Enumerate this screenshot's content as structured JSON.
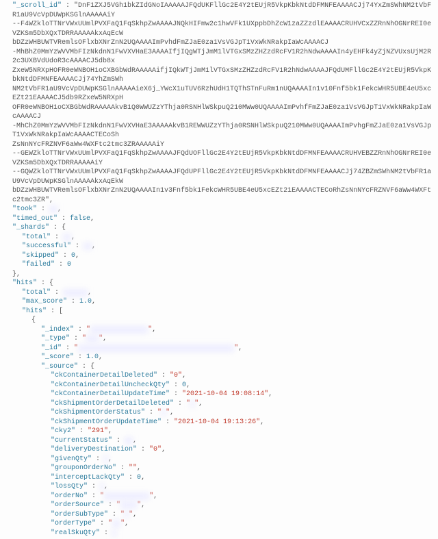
{
  "scroll_id_key": "\"_scroll_id\"",
  "scroll_id_lines": [
    "\"DnF1ZXJ5VGh1bkZIdGNoIAAAAAJFQdUKFllGc2E4Y2tEUjR5VkpKbkNtdDFMNFEAAAACJj74YxZmSWhNM2tVbFR1aU9VcVpDUWpKSGlnAAAAAiY",
    "--F4WZkloTTNrVWxUUmlPVXFaQ1FqSkhpZwAAAAJNQkHIFmw2c1hwVFk1UXppbDhZcW1zaZZzdlEAAAACRUHVCxZZRnNhOGNrREI0eVZKSm5DbXQxTDRRAAAAAkxAqEcW",
    "bDZzWHBUWTVRemlsOFlxbXNrZnN2UQAAAAImPvhdFmZJaE0za1VsVGJpT1VxWkNRakpIaWcAAAACJ",
    "-MhBhZ0MmYzWVVMbFIzNkdnN1FwVXVHaE3AAAAIfjIQgWTjJmM1lVTGxSMzZHZzdRcFV1R2hNdwAAAAIn4yEHFk4yZjNZVUxsUjM2R2c3UXBVdUdoR3cAAAACJ5db8x",
    "ZxeW5NRXpHOFR0eWNBOH1oCXBGbWdRAAAAAifjIQkWTjJmM1lVTGxSMzZHZzdRcFV1R2hNdwAAAAJFQdUMFllGc2E4Y2tEUjR5VkpKbkNtdDFMNFEAAAACJj74YhZmSWh",
    "NM2tVbFR1aU9VcVpDUWpKSGlnAAAAAieX6j_YWcX1uTUV6RzhUdH1TQThSTnFuRm1nUQAAAAIn1v10Fnf5bk1FekcWHR5UBE4eU5xcEZt21EAAAACJ5db9RZxeW5NRXpH",
    "OFR0eWNBOH1oCXBGbWdRAAAAAkvB1Q0WWUZzYThja0RSNHlWSkpuQ210MWw0UQAAAAImPvhfFmZJaE0za1VsVGJpT1VxWkNRakpIaWcAAAACJ",
    "-MhChZ0MmYzWVVMbFIzNkdnN1FwVXVHaE3AAAAAkvB1REWWUZzYThja0RSNHlWSkpuQ210MWw0UQAAAAImPvhgFmZJaE0za1VsVGJpT1VxWkNRakpIaWcAAAACTECoSh",
    "ZsNnNYcFRZNVF6aWw4WXFtc2tmc3ZRAAAAAiY",
    "--GEWZkloTTNrVWxUUmlPVXFaQ1FqSkhpZwAAAAJFQdUOFllGc2E4Y2tEUjR5VkpKbkNtdDFMNFEAAAACRUHVEBZZRnNhOGNrREI0eVZKSm5DbXQxTDRRAAAAAiY",
    "--GQWZkloTTNrVWxUUmlPVXFaQ1FqSkhpZwAAAAJFQdUPFllGc2E4Y2tEUjR5VkpKbkNtdDFMNFEAAAACJj74ZBZmSWhNM2tVbFR1aU9VcVpDUWpKSGlnAAAAAkxAqEkW",
    "bDZzWHBUWTVRemlsOFlxbXNrZnN2UQAAAAIn1v3Fnf5bk1FekcWHR5UBE4eU5xcEZt21EAAAACTECoRhZsNnNYcFRZNVF6aWw4WXFtc2tmc3ZR\","
  ],
  "fields": {
    "took_key": "\"took\"",
    "timed_out_key": "\"timed_out\"",
    "timed_out_val": "false",
    "shards_key": "\"_shards\"",
    "total_key": "\"total\"",
    "successful_key": "\"successful\"",
    "skipped_key": "\"skipped\"",
    "skipped_val": "0",
    "failed_key": "\"failed\"",
    "failed_val": "0",
    "hits_key": "\"hits\"",
    "max_score_key": "\"max_score\"",
    "max_score_val": "1.0",
    "hits_inner_key": "\"hits\"",
    "index_key": "\"_index\"",
    "type_key": "\"_type\"",
    "id_key": "\"_id\"",
    "score_key": "\"_score\"",
    "score_val": "1.0",
    "source_key": "\"_source\"",
    "ckContainerDetailDeleted_k": "\"ckContainerDetailDeleted\"",
    "ckContainerDetailDeleted_v": "\"0\"",
    "ckContainerDetailUncheckQty_k": "\"ckContainerDetailUncheckQty\"",
    "ckContainerDetailUncheckQty_v": "0",
    "ckContainerDetailUpdateTime_k": "\"ckContainerDetailUpdateTime\"",
    "ckContainerDetailUpdateTime_v": "\"2021-10-04 19:08:14\"",
    "ckShipmentOrderDetailDeleted_k": "\"ckShipmentOrderDetailDeleted\"",
    "ckShipmentOrderStatus_k": "\"ckShipmentOrderStatus\"",
    "ckShipmentOrderUpdateTime_k": "\"ckShipmentOrderUpdateTime\"",
    "ckShipmentOrderUpdateTime_v": "\"2021-10-04 19:13:26\"",
    "cky2_k": "\"cky2\"",
    "cky2_v": "\"291\"",
    "currentStatus_k": "\"currentStatus\"",
    "deliveryDestination_k": "\"deliveryDestination\"",
    "deliveryDestination_v": "\"0\"",
    "givenQty_k": "\"givenQty\"",
    "grouponOrderNo_k": "\"grouponOrderNo\"",
    "grouponOrderNo_v": "\"\"",
    "interceptLackQty_k": "\"interceptLackQty\"",
    "interceptLackQty_v": "0",
    "lossQty_k": "\"lossQty\"",
    "orderNo_k": "\"orderNo\"",
    "orderSource_k": "\"orderSource\"",
    "orderSubType_k": "\"orderSubType\"",
    "orderType_k": "\"orderType\"",
    "realSkuQty_k": "\"realSkuQty\""
  }
}
